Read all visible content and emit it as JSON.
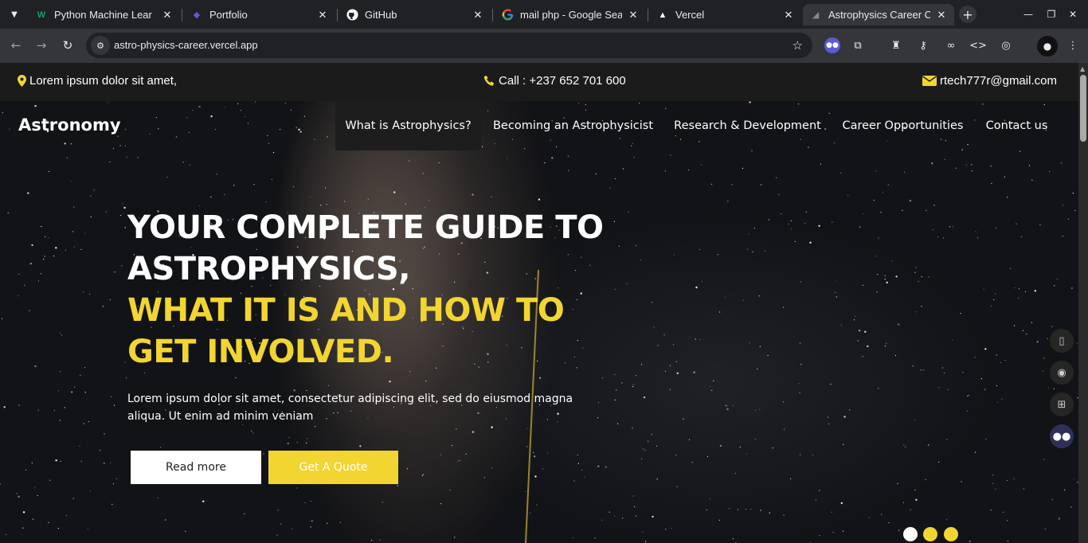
{
  "browser": {
    "tabs": [
      {
        "title": "Python Machine Lear",
        "favicon": "w-logo-icon",
        "favicon_glyph": "W",
        "favicon_color": "#1a9e6b",
        "active": false
      },
      {
        "title": "Portfolio",
        "favicon": "portfolio-icon",
        "favicon_glyph": "◆",
        "favicon_color": "#3a3a8c",
        "active": false
      },
      {
        "title": "GitHub",
        "favicon": "github-icon",
        "favicon_glyph": "●",
        "favicon_color": "#ffffff",
        "active": false
      },
      {
        "title": "mail php - Google Sea",
        "favicon": "google-icon",
        "favicon_glyph": "G",
        "favicon_color": "#4285f4",
        "active": false
      },
      {
        "title": "Vercel",
        "favicon": "vercel-icon",
        "favicon_glyph": "▲",
        "favicon_color": "#ffffff",
        "active": false
      },
      {
        "title": "Astrophysics Career C",
        "favicon": "site-favicon-icon",
        "favicon_glyph": "◢",
        "favicon_color": "#888888",
        "active": true
      }
    ],
    "url": "astro-physics-career.vercel.app"
  },
  "site": {
    "topbar": {
      "address": "Lorem ipsum dolor sit amet,",
      "phone": "Call : +237 652 701 600",
      "email": "rtech777r@gmail.com"
    },
    "brand": "Astronomy",
    "nav": [
      {
        "label": "What is Astrophysics?",
        "active": true
      },
      {
        "label": "Becoming an Astrophysicist",
        "active": false
      },
      {
        "label": "Research & Development",
        "active": false
      },
      {
        "label": "Career Opportunities",
        "active": false
      },
      {
        "label": "Contact us",
        "active": false
      }
    ],
    "hero": {
      "title_white_line1": "YOUR COMPLETE GUIDE TO",
      "title_white_line2": "ASTROPHYSICS,",
      "title_yellow_line1": "WHAT IT IS AND HOW TO",
      "title_yellow_line2": "GET INVOLVED.",
      "text": "Lorem ipsum dolor sit amet, consectetur adipiscing elit, sed do eiusmod magna aliqua. Ut enim ad minim veniam",
      "read_more": "Read more",
      "quote": "Get A Quote"
    },
    "slider_dots": [
      {
        "active": true
      },
      {
        "active": false
      },
      {
        "active": false
      }
    ]
  },
  "colors": {
    "accent": "#f2d531",
    "white": "#ffffff"
  }
}
